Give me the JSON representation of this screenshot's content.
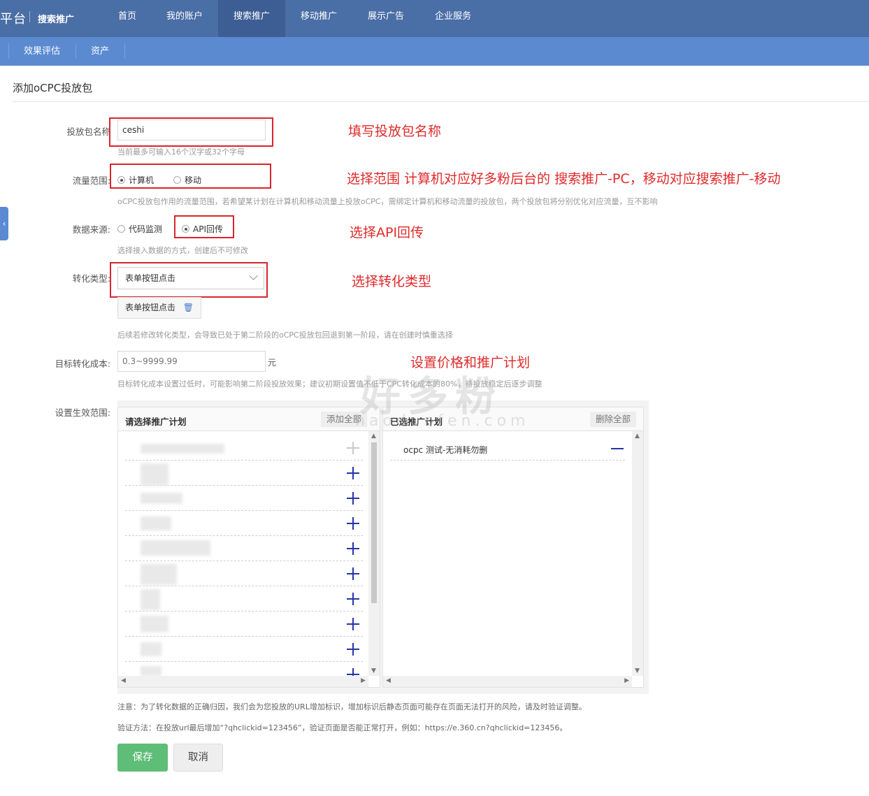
{
  "header": {
    "brand": "平台",
    "brand_sub": "搜索推广",
    "nav": [
      "首页",
      "我的账户",
      "搜索推广",
      "移动推广",
      "展示广告",
      "企业服务"
    ],
    "active_nav": "搜索推广",
    "subnav": [
      "效果评估",
      "资产"
    ]
  },
  "page": {
    "title": "添加oCPC投放包",
    "side_tab": "‹"
  },
  "form": {
    "name": {
      "label": "投放包名称",
      "value": "ceshi",
      "hint": "当前最多可输入16个汉字或32个字母"
    },
    "traffic": {
      "label": "流量范围:",
      "options": [
        "计算机",
        "移动"
      ],
      "selected": "计算机",
      "hint": "oCPC投放包作用的流量范围，若希望某计划在计算机和移动流量上投放oCPC，需绑定计算机和移动流量的投放包，两个投放包将分别优化对应流量，互不影响"
    },
    "source": {
      "label": "数据来源:",
      "options": [
        "代码监测",
        "API回传"
      ],
      "selected": "API回传",
      "hint": "选择接入数据的方式，创建后不可修改"
    },
    "conversion": {
      "label": "转化类型:",
      "selected": "表单按钮点击",
      "tag": "表单按钮点击",
      "hint": "后续若修改转化类型，会导致已处于第二阶段的oCPC投放包回退到第一阶段，请在创建时慎重选择"
    },
    "cost": {
      "label": "目标转化成本:",
      "placeholder": "0.3~9999.99",
      "unit": "元",
      "hint": "目标转化成本设置过低时，可能影响第二阶段投放效果；建议初期设置值不低于CPC转化成本的80%，待投放稳定后逐步调整"
    },
    "scope": {
      "label": "设置生效范围:"
    }
  },
  "panels": {
    "left": {
      "title": "请选择推广计划",
      "action": "添加全部"
    },
    "right": {
      "title": "已选推广计划",
      "action": "删除全部",
      "items": [
        "ocpc 测试-无消耗勿删"
      ]
    }
  },
  "annotations": {
    "a1": "填写投放包名称",
    "a2": "选择范围 计算机对应好多粉后台的 搜索推广-PC，移动对应搜索推广-移动",
    "a3": "选择API回传",
    "a4": "选择转化类型",
    "a5": "设置价格和推广计划"
  },
  "watermark": {
    "text": "好多粉",
    "sub": "haoduofen.com"
  },
  "notes": {
    "n1": "注意：为了转化数据的正确归因，我们会为您投放的URL增加标识，增加标识后静态页面可能存在页面无法打开的风险，请及时验证调整。",
    "n2": "验证方法：在投放url最后增加“?qhclickid=123456”，验证页面是否能正常打开，例如：https://e.360.cn?qhclickid=123456。"
  },
  "buttons": {
    "save": "保存",
    "cancel": "取消"
  },
  "colors": {
    "topbar": "#4a6ea6",
    "subbar": "#5b8ad1",
    "annotation": "#e02a2a",
    "save": "#5ebd77",
    "plus": "#2633a8"
  }
}
